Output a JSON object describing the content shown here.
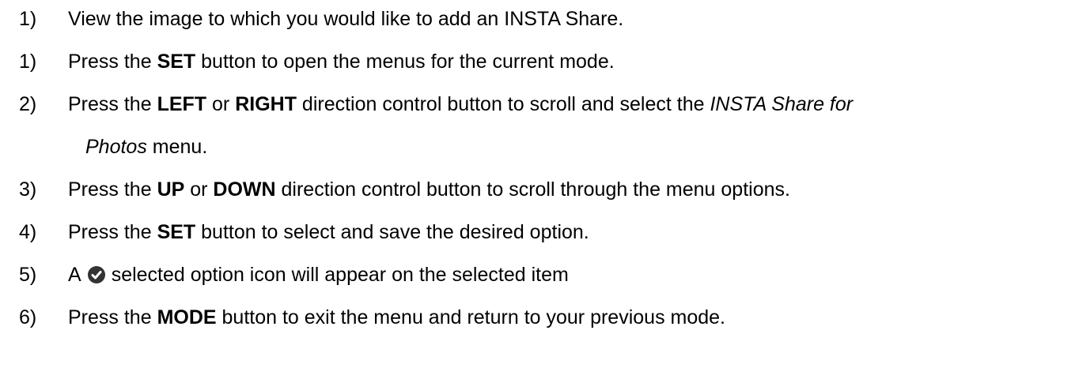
{
  "steps": [
    {
      "number": "1)",
      "parts": [
        "View the image to which you would like to add an INSTA Share."
      ]
    },
    {
      "number": "1)",
      "parts": [
        "Press the ",
        "SET",
        " button to open the menus for the current mode."
      ]
    },
    {
      "number": "2)",
      "parts": [
        "Press the ",
        "LEFT",
        " or ",
        "RIGHT",
        " direction control button to scroll and select the ",
        "INSTA Share for"
      ],
      "continuation": [
        "Photos",
        " menu."
      ]
    },
    {
      "number": "3)",
      "parts": [
        "Press the ",
        "UP",
        " or ",
        "DOWN",
        " direction control button to scroll through the menu options."
      ]
    },
    {
      "number": "4)",
      "parts": [
        "Press the ",
        "SET",
        " button to select and save the desired option."
      ]
    },
    {
      "number": "5)",
      "parts": [
        "A",
        "selected option icon will appear on the selected item"
      ],
      "icon": "check-circle-icon"
    },
    {
      "number": "6)",
      "parts": [
        "Press the ",
        "MODE",
        " button to exit the menu and return to your previous mode."
      ]
    }
  ]
}
